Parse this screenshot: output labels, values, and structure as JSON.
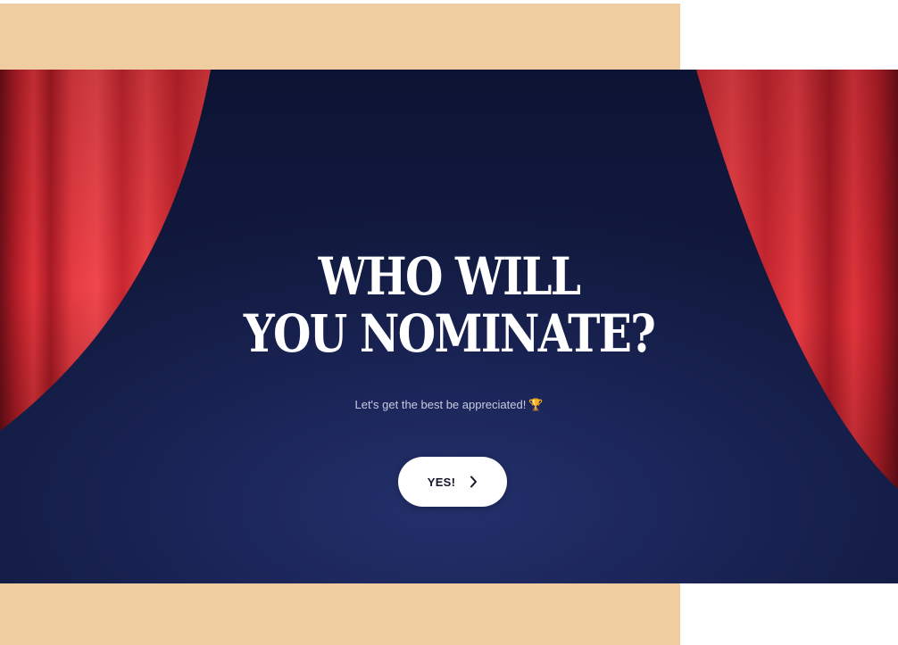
{
  "hero": {
    "headline_line1": "WHO WILL",
    "headline_line2": "YOU NOMINATE?",
    "tagline": "Let's get the best be appreciated!",
    "tagline_icon": "trophy-icon",
    "cta_label": "YES!",
    "cta_icon": "chevron-right-icon"
  },
  "colors": {
    "band": "#efcda1",
    "stage_background": "#1b2558",
    "curtain_red": "#e63a41",
    "headline_text": "#ffffff",
    "button_background": "#ffffff",
    "button_text": "#15152b"
  }
}
